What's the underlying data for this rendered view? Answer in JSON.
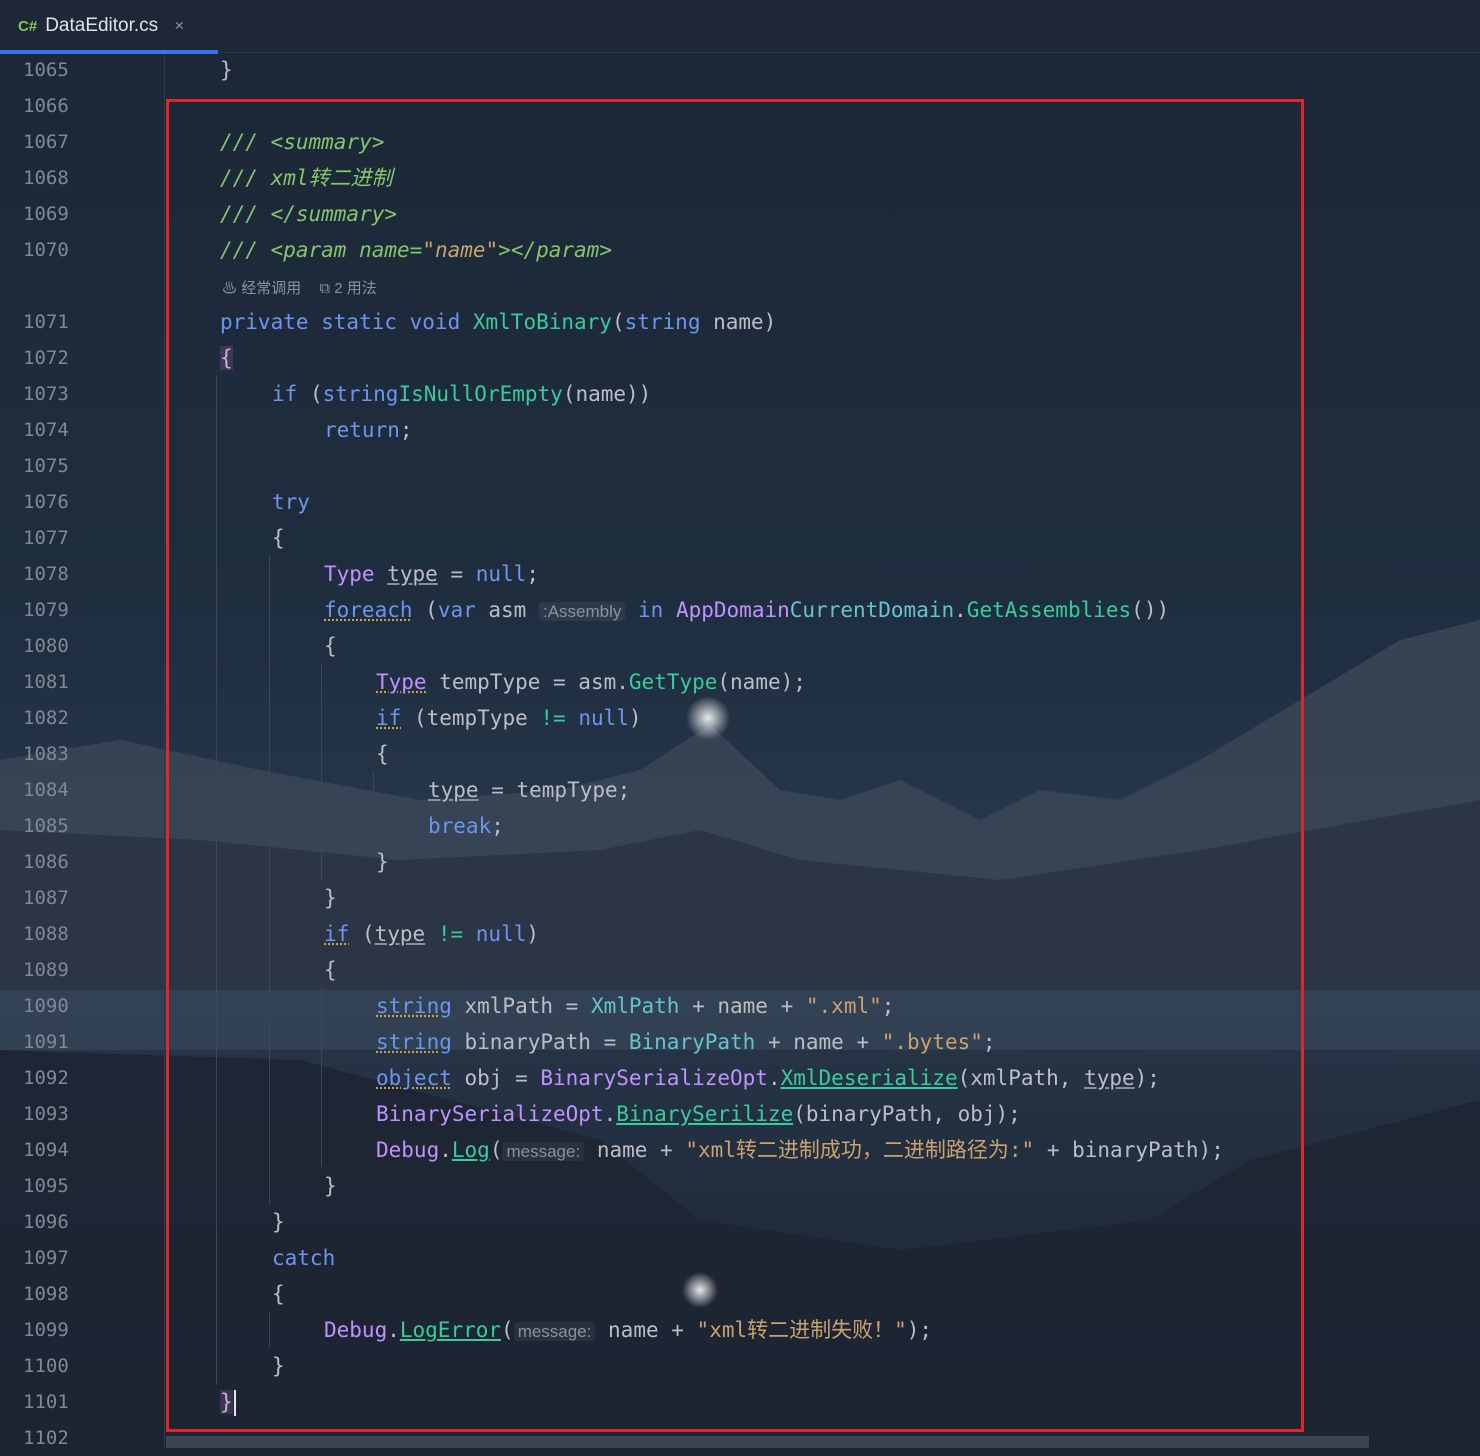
{
  "tab": {
    "lang": "C#",
    "title": "DataEditor.cs",
    "close": "×"
  },
  "lens": {
    "usage": "经常调用",
    "count": "2 用法"
  },
  "lines": [
    {
      "n": "1065"
    },
    {
      "n": "1066"
    },
    {
      "n": "1067"
    },
    {
      "n": "1068"
    },
    {
      "n": "1069"
    },
    {
      "n": "1070"
    },
    {
      "n": "1071"
    },
    {
      "n": "1072"
    },
    {
      "n": "1073"
    },
    {
      "n": "1074"
    },
    {
      "n": "1075"
    },
    {
      "n": "1076"
    },
    {
      "n": "1077"
    },
    {
      "n": "1078"
    },
    {
      "n": "1079"
    },
    {
      "n": "1080"
    },
    {
      "n": "1081"
    },
    {
      "n": "1082"
    },
    {
      "n": "1083"
    },
    {
      "n": "1084"
    },
    {
      "n": "1085"
    },
    {
      "n": "1086"
    },
    {
      "n": "1087"
    },
    {
      "n": "1088"
    },
    {
      "n": "1089"
    },
    {
      "n": "1090"
    },
    {
      "n": "1091"
    },
    {
      "n": "1092"
    },
    {
      "n": "1093"
    },
    {
      "n": "1094"
    },
    {
      "n": "1095"
    },
    {
      "n": "1096"
    },
    {
      "n": "1097"
    },
    {
      "n": "1098"
    },
    {
      "n": "1099"
    },
    {
      "n": "1100"
    },
    {
      "n": "1101"
    },
    {
      "n": "1102"
    }
  ],
  "code": {
    "l1065": "}",
    "l1067": "/// <summary>",
    "l1068": "/// xml转二进制",
    "l1069": "/// </summary>",
    "l1070": {
      "a": "/// <",
      "b": "param",
      "c": " name",
      "d": "=",
      "e": "\"name\"",
      "f": "></",
      "g": "param",
      "h": ">"
    },
    "l1071": {
      "a": "private static void ",
      "b": "XmlToBinary",
      "c": "(",
      "d": "string",
      "e": " name)"
    },
    "l1072": "{",
    "l1073": {
      "a": "if ",
      "b": "(",
      "c": "string",
      ".": ".",
      "d": "IsNullOrEmpty",
      "e": "(name))"
    },
    "l1074": {
      "a": "return",
      ";": ";"
    },
    "l1076": "try",
    "l1077": "{",
    "l1078": {
      "a": "Type",
      "b": " ",
      "c": "type",
      "d": " = ",
      "e": "null",
      ";": ";"
    },
    "l1079": {
      "a": "foreach",
      "b": " (",
      "c": "var",
      "d": " asm ",
      "hint": ":Assembly",
      "e": " in ",
      "f": "AppDomain",
      ".": ".",
      "g": "CurrentDomain",
      "h": ".",
      "i": "GetAssemblies",
      "j": "())"
    },
    "l1080": "{",
    "l1081": {
      "a": "Type",
      "b": " tempType = asm.",
      "c": "GetType",
      "d": "(name);"
    },
    "l1082": {
      "a": "if",
      "b": " (tempType ",
      "c": "!=",
      "d": " ",
      "e": "null",
      "f": ")"
    },
    "l1083": "{",
    "l1084": {
      "a": "type",
      "b": " = tempType;"
    },
    "l1085": {
      "a": "break",
      ";": ";"
    },
    "l1086": "}",
    "l1087": "}",
    "l1088": {
      "a": "if",
      "b": " (",
      "c": "type",
      "d": " ",
      "e": "!=",
      "f": " ",
      "g": "null",
      "h": ")"
    },
    "l1089": "{",
    "l1090": {
      "a": "string",
      "b": " xmlPath = ",
      "c": "XmlPath",
      "d": " + name + ",
      "e": "\".xml\"",
      "f": ";"
    },
    "l1091": {
      "a": "string",
      "b": " binaryPath = ",
      "c": "BinaryPath",
      "d": " + name + ",
      "e": "\".bytes\"",
      "f": ";"
    },
    "l1092": {
      "a": "object",
      "b": " obj = ",
      "c": "BinarySerializeOpt",
      "d": ".",
      "e": "XmlDeserialize",
      "f": "(xmlPath, ",
      "g": "type",
      "h": ");"
    },
    "l1093": {
      "a": "BinarySerializeOpt",
      "b": ".",
      "c": "BinarySerilize",
      "d": "(binaryPath, obj);"
    },
    "l1094": {
      "a": "Debug",
      "b": ".",
      "c": "Log",
      "d": "(",
      "hint": "message:",
      "e": " name + ",
      "f": "\"xml转二进制成功，二进制路径为:\"",
      "g": " + binaryPath);"
    },
    "l1095": "}",
    "l1096": "}",
    "l1097": "catch",
    "l1098": "{",
    "l1099": {
      "a": "Debug",
      "b": ".",
      "c": "LogError",
      "d": "(",
      "hint": "message:",
      "e": " name + ",
      "f": "\"xml转二进制失败！\"",
      "g": ");"
    },
    "l1100": "}",
    "l1101": "}"
  }
}
